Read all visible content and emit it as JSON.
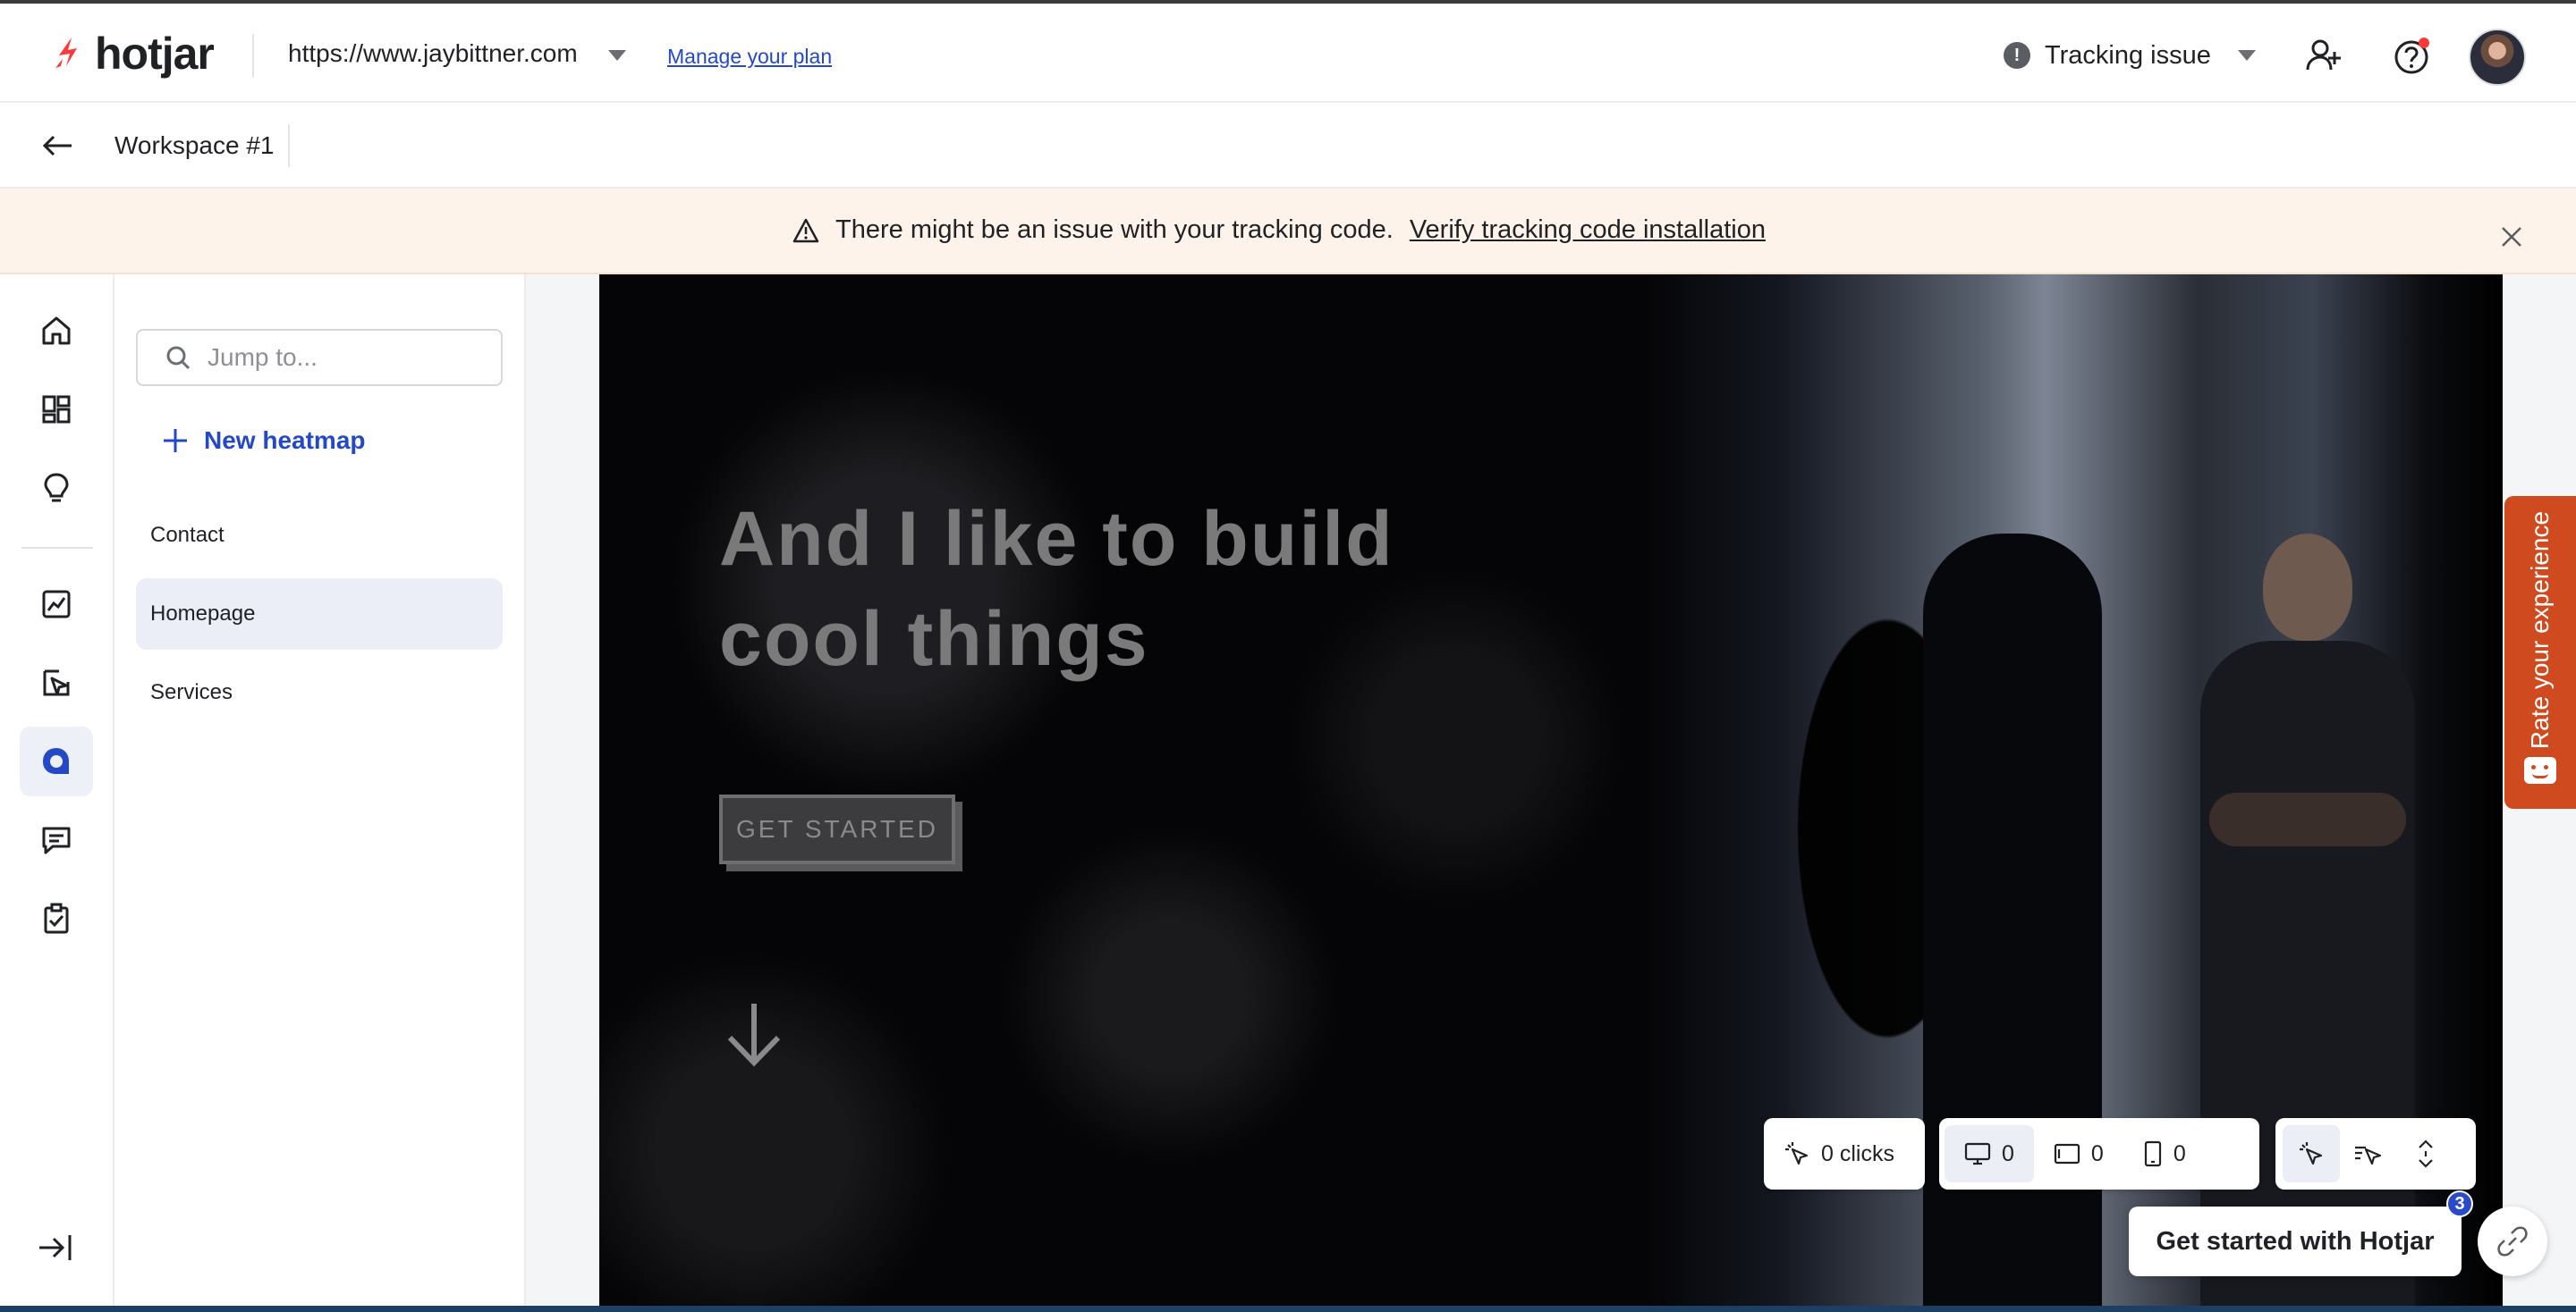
{
  "brand": {
    "name": "hotjar",
    "accent": "#fd3a3a"
  },
  "header": {
    "site_url": "https://www.jaybittner.com",
    "manage_plan": "Manage your plan",
    "tracking_status": "Tracking issue",
    "tracking_icon": "!"
  },
  "workspace": {
    "title": "Workspace #1"
  },
  "banner": {
    "message": "There might be an issue with your tracking code.",
    "link": "Verify tracking code installation"
  },
  "sidebar": {
    "items": [
      {
        "icon": "home-icon"
      },
      {
        "icon": "dashboard-icon"
      },
      {
        "icon": "lightbulb-icon"
      },
      {
        "icon": "trends-icon"
      },
      {
        "icon": "recordings-icon"
      },
      {
        "icon": "heatmaps-icon",
        "active": true
      },
      {
        "icon": "feedback-icon"
      },
      {
        "icon": "surveys-icon"
      }
    ]
  },
  "panel": {
    "search_placeholder": "Jump to...",
    "new_heatmap": "New heatmap",
    "pages": [
      {
        "label": "Contact"
      },
      {
        "label": "Homepage",
        "active": true
      },
      {
        "label": "Services"
      }
    ]
  },
  "preview": {
    "headline_line1": "And I like to build",
    "headline_line2": "cool things",
    "cta": "GET STARTED"
  },
  "stats": {
    "clicks": "0 clicks",
    "desktop": "0",
    "tablet": "0",
    "mobile": "0"
  },
  "get_started": {
    "label": "Get started with Hotjar",
    "badge": "3"
  },
  "feedback_tab": {
    "label": "Rate your experience"
  }
}
